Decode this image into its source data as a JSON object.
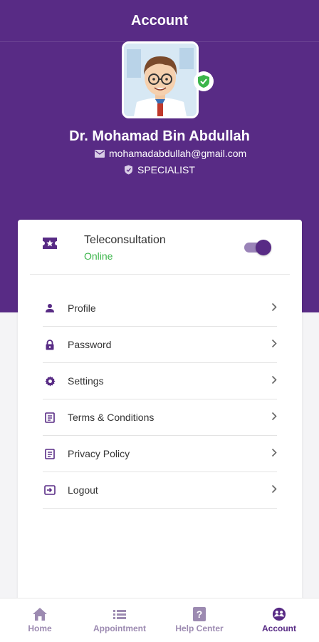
{
  "header": {
    "title": "Account"
  },
  "profile": {
    "name": "Dr. Mohamad Bin Abdullah",
    "email": "mohamadabdullah@gmail.com",
    "role": "SPECIALIST"
  },
  "teleconsultation": {
    "title": "Teleconsultation",
    "status": "Online",
    "enabled": true
  },
  "menu": {
    "items": [
      {
        "label": "Profile",
        "icon": "person-icon"
      },
      {
        "label": "Password",
        "icon": "lock-icon"
      },
      {
        "label": "Settings",
        "icon": "gear-icon"
      },
      {
        "label": "Terms & Conditions",
        "icon": "document-icon"
      },
      {
        "label": "Privacy Policy",
        "icon": "document-icon"
      },
      {
        "label": "Logout",
        "icon": "logout-icon"
      }
    ]
  },
  "nav": {
    "items": [
      {
        "label": "Home",
        "icon": "home-icon",
        "active": false
      },
      {
        "label": "Appointment",
        "icon": "list-icon",
        "active": false
      },
      {
        "label": "Help Center",
        "icon": "help-icon",
        "active": false
      },
      {
        "label": "Account",
        "icon": "account-icon",
        "active": true
      }
    ]
  },
  "colors": {
    "primary": "#582b85",
    "online": "#3bb54a",
    "inactive_nav": "#9c8ab1"
  }
}
